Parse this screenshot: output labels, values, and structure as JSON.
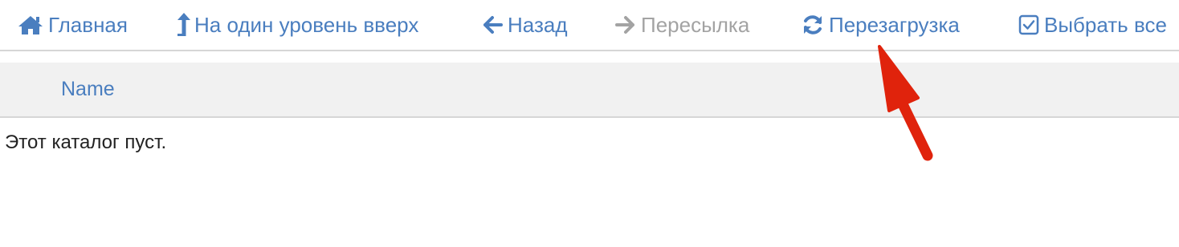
{
  "toolbar": {
    "items": [
      {
        "label": "Главная",
        "icon": "home-icon"
      },
      {
        "label": "На один уровень вверх",
        "icon": "level-up-icon"
      },
      {
        "label": "Назад",
        "icon": "arrow-left-icon"
      },
      {
        "label": "Пересылка",
        "icon": "arrow-right-icon",
        "disabled": true
      },
      {
        "label": "Перезагрузка",
        "icon": "refresh-icon"
      },
      {
        "label": "Выбрать все",
        "icon": "checkbox-icon"
      }
    ]
  },
  "table": {
    "columns": [
      "Name"
    ],
    "empty_message": "Этот каталог пуст."
  },
  "colors": {
    "link": "#4a7ebf",
    "disabled": "#a3a3a3",
    "header_bg": "#f1f1f1",
    "annotation_arrow": "#e0230c"
  }
}
